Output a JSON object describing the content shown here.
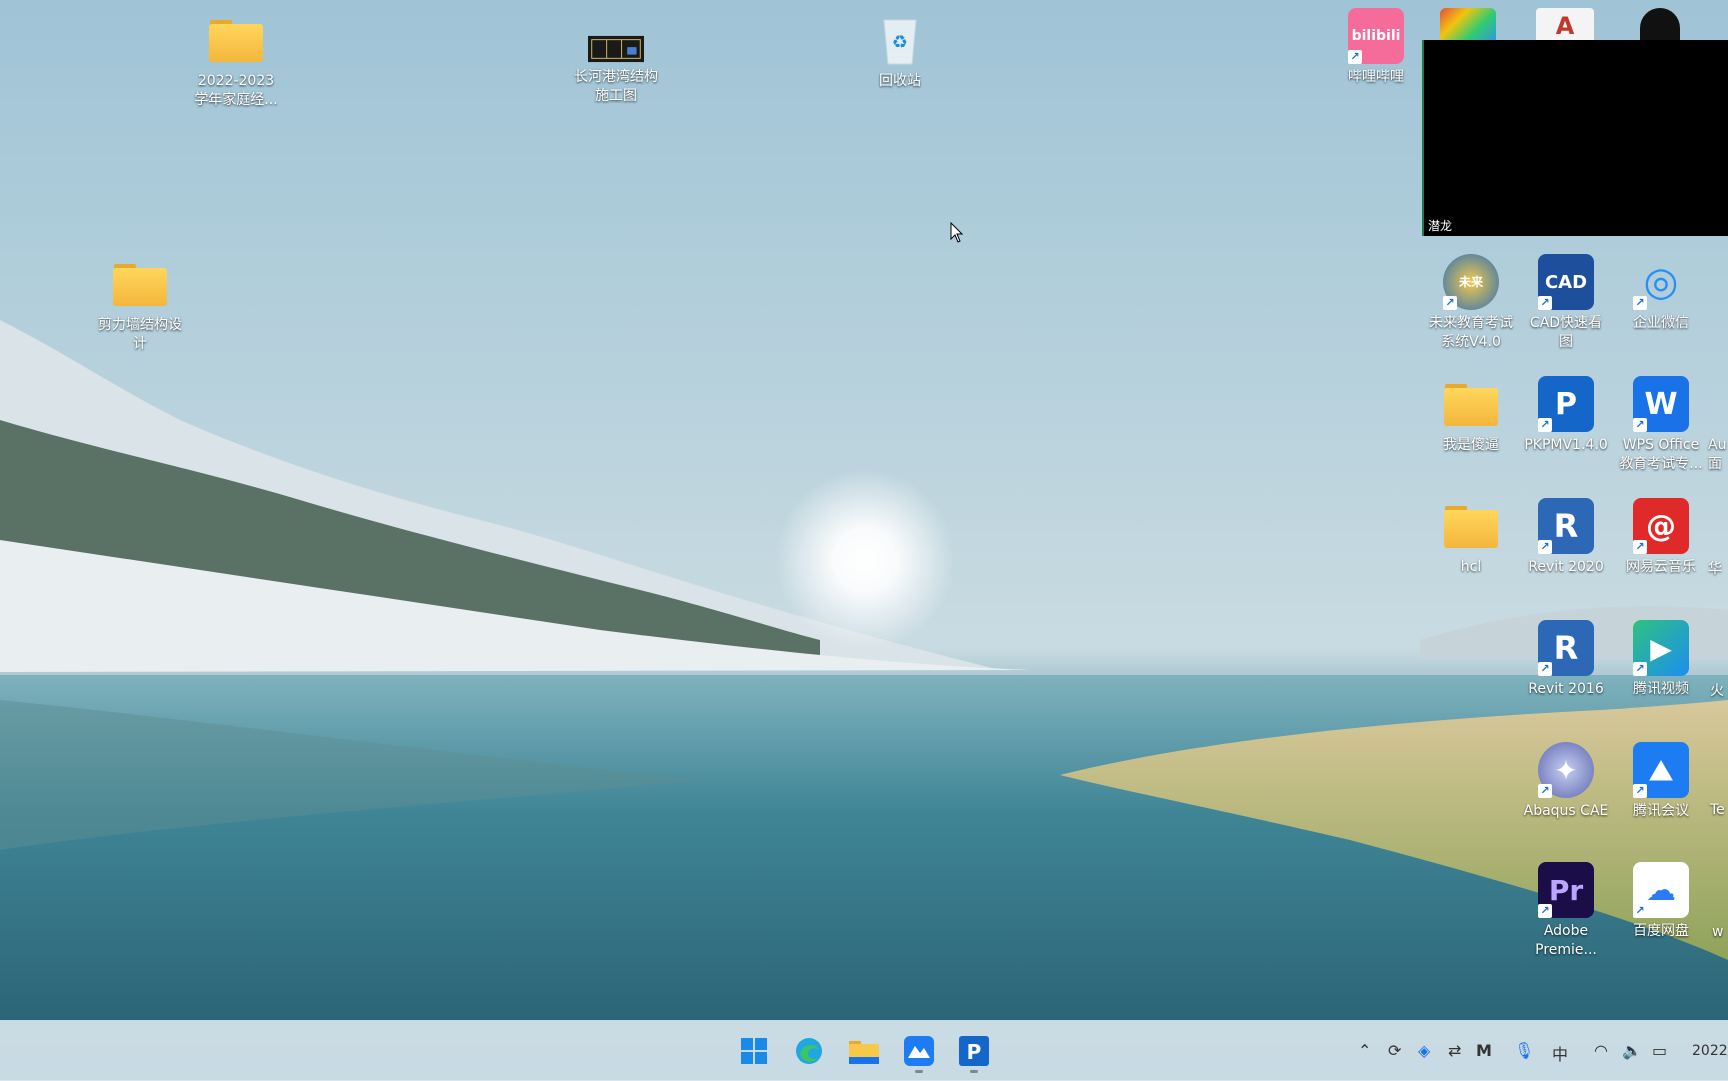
{
  "desktop": {
    "icons_left": [
      {
        "label_line1": "2022-2023",
        "label_line2": "学年家庭经...",
        "icon": "folder-icon"
      },
      {
        "label_line1": "长河港湾结构",
        "label_line2": "施工图",
        "icon": "blueprint-image-icon"
      },
      {
        "label_line1": "回收站",
        "label_line2": "",
        "icon": "recycle-bin-icon"
      },
      {
        "label_line1": "剪力墙结构设",
        "label_line2": "计",
        "icon": "folder-icon"
      }
    ],
    "icons_right": [
      {
        "label_line1": "哔哩哔哩",
        "label_line2": "",
        "icon": "bilibili-icon",
        "color": "#f56b9a",
        "glyph": "bilibili"
      },
      {
        "label_line1": "未来教育考试",
        "label_line2": "系统V4.0",
        "icon": "future-education-icon",
        "color": "#2a6fb8",
        "glyph": ""
      },
      {
        "label_line1": "CAD快速看",
        "label_line2": "图",
        "icon": "cad-viewer-icon",
        "color": "#1d4f9c",
        "glyph": "CAD"
      },
      {
        "label_line1": "企业微信",
        "label_line2": "",
        "icon": "wecom-icon",
        "color": "#2b8ef0",
        "glyph": "◎"
      },
      {
        "label_line1": "我是傻逼",
        "label_line2": "",
        "icon": "folder-icon"
      },
      {
        "label_line1": "PKPMV1.4.0",
        "label_line2": "",
        "icon": "pkpm-icon",
        "color": "#1467c9",
        "glyph": "P"
      },
      {
        "label_line1": "WPS Office",
        "label_line2": "教育考试专...",
        "icon": "wps-icon",
        "color": "#1a72e8",
        "glyph": "W"
      },
      {
        "label_line1": "hcl",
        "label_line2": "",
        "icon": "folder-icon"
      },
      {
        "label_line1": "Revit 2020",
        "label_line2": "",
        "icon": "revit-icon",
        "color": "#2d68b6",
        "glyph": "R"
      },
      {
        "label_line1": "网易云音乐",
        "label_line2": "",
        "icon": "netease-music-icon",
        "color": "#e02a2a",
        "glyph": "@"
      },
      {
        "label_line1": "Revit 2016",
        "label_line2": "",
        "icon": "revit-icon",
        "color": "#2d68b6",
        "glyph": "R"
      },
      {
        "label_line1": "腾讯视频",
        "label_line2": "",
        "icon": "tencent-video-icon",
        "color": "#2ec27e",
        "glyph": "▶"
      },
      {
        "label_line1": "Abaqus CAE",
        "label_line2": "",
        "icon": "abaqus-icon",
        "color": "#7a86c8",
        "glyph": "✦"
      },
      {
        "label_line1": "腾讯会议",
        "label_line2": "",
        "icon": "tencent-meeting-icon",
        "color": "#1d7cf2",
        "glyph": "⛰"
      },
      {
        "label_line1": "Adobe",
        "label_line2": "Premie...",
        "icon": "premiere-icon",
        "color": "#1b0d47",
        "glyph": "Pr"
      },
      {
        "label_line1": "百度网盘",
        "label_line2": "",
        "icon": "baidu-netdisk-icon",
        "color": "#ffffff",
        "glyph": "☁"
      }
    ],
    "partial_right": [
      {
        "label": "Au",
        "label2": "面"
      },
      {
        "label": "华",
        "label2": ""
      },
      {
        "label": "火",
        "label2": ""
      },
      {
        "label": "Te",
        "label2": ""
      },
      {
        "label": "w",
        "label2": ""
      }
    ],
    "top_row_partial": [
      {
        "icon": "colorful-app-icon",
        "color": "#e74c3c"
      },
      {
        "icon": "autocad-icon",
        "color": "#c0392b"
      },
      {
        "icon": "qq-icon",
        "color": "#111111"
      }
    ]
  },
  "video_overlay": {
    "name": "潜龙"
  },
  "taskbar": {
    "apps": [
      {
        "name": "start-button",
        "icon": "windows-icon"
      },
      {
        "name": "edge-button",
        "icon": "edge-icon"
      },
      {
        "name": "file-explorer-button",
        "icon": "folder-icon"
      },
      {
        "name": "tencent-meeting-button",
        "icon": "tencent-meeting-icon"
      },
      {
        "name": "pkpm-button",
        "icon": "pkpm-icon"
      }
    ],
    "tray": {
      "ime": "中",
      "clock": "2022/"
    }
  },
  "colors": {
    "accent": "#1a72e8",
    "taskbar": "#d6e4eb"
  }
}
